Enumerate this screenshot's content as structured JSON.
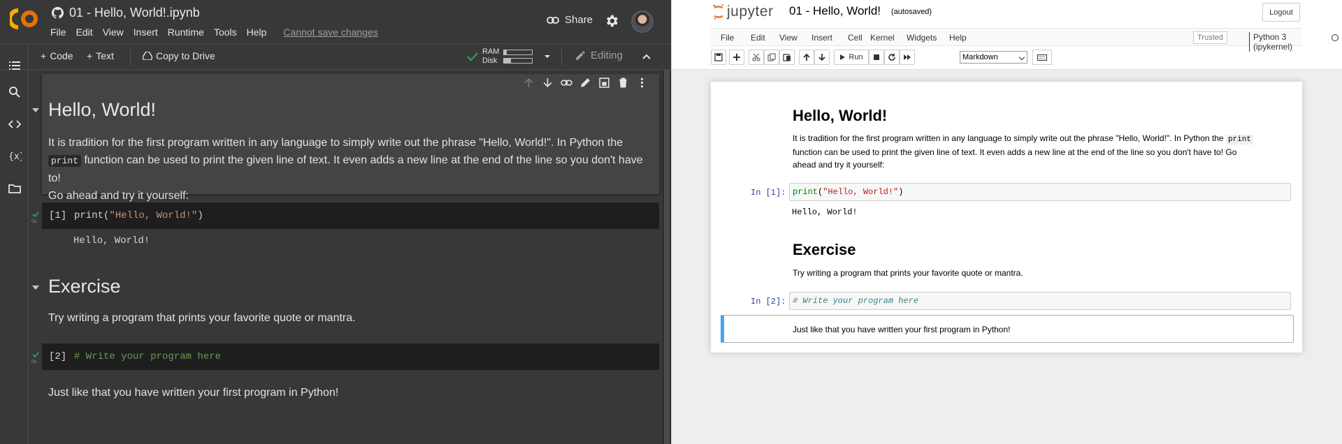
{
  "colab": {
    "notebook_title": "01 - Hello, World!.ipynb",
    "menu": [
      "File",
      "Edit",
      "View",
      "Insert",
      "Runtime",
      "Tools",
      "Help"
    ],
    "cannot_save": "Cannot save changes",
    "share_label": "Share",
    "toolbar": {
      "add_code": "Code",
      "add_text": "Text",
      "copy_to_drive": "Copy to Drive",
      "ram_label": "RAM",
      "disk_label": "Disk",
      "ram_fraction": 0.1,
      "disk_fraction": 0.25,
      "editing_label": "Editing"
    },
    "cells": {
      "heading1": "Hello, World!",
      "para1_a": "It is tradition for the first program written in any language to simply write out the phrase \"Hello, World!\". In Python the",
      "para1_code": "print",
      "para1_b": "function can be used to print the given line of text. It even adds a new line at the end of the line so you don't have to!",
      "para1_c": "Go ahead and try it yourself:",
      "code1_exec": "[1]",
      "code1_fn": "print(",
      "code1_str": "\"Hello, World!\"",
      "code1_close": ")",
      "code1_time": "0s",
      "output1": "Hello, World!",
      "heading2": "Exercise",
      "para2": "Try writing a program that prints your favorite quote or mantra.",
      "code2_exec": "[2]",
      "code2_comment": "# Write your program here",
      "code2_time": "0s",
      "para3": "Just like that you have written your first program in Python!"
    }
  },
  "jupyter": {
    "logo_text": "jupyter",
    "notebook_name": "01 - Hello, World!",
    "autosave": "(autosaved)",
    "logout": "Logout",
    "menu": [
      "File",
      "Edit",
      "View",
      "Insert",
      "Cell",
      "Kernel",
      "Widgets",
      "Help"
    ],
    "trusted": "Trusted",
    "kernel": "Python 3 (ipykernel)",
    "run_label": "Run",
    "cell_type": "Markdown",
    "cells": {
      "heading1": "Hello, World!",
      "para1_a": "It is tradition for the first program written in any language to simply write out the phrase \"Hello, World!\". In Python the",
      "para1_code": "print",
      "para1_b": "function can be used to print the given line of text. It even adds a new line at the end of the line so you don't have to! Go",
      "para1_c": "ahead and try it yourself:",
      "prompt1": "In [1]:",
      "code1_fn": "print",
      "code1_open": "(",
      "code1_str": "\"Hello, World!\"",
      "code1_close": ")",
      "output1": "Hello, World!",
      "heading2": "Exercise",
      "para2": "Try writing a program that prints your favorite quote or mantra.",
      "prompt2": "In [2]:",
      "code2_comment": "# Write your program here",
      "para3": "Just like that you have written your first program in Python!"
    }
  }
}
